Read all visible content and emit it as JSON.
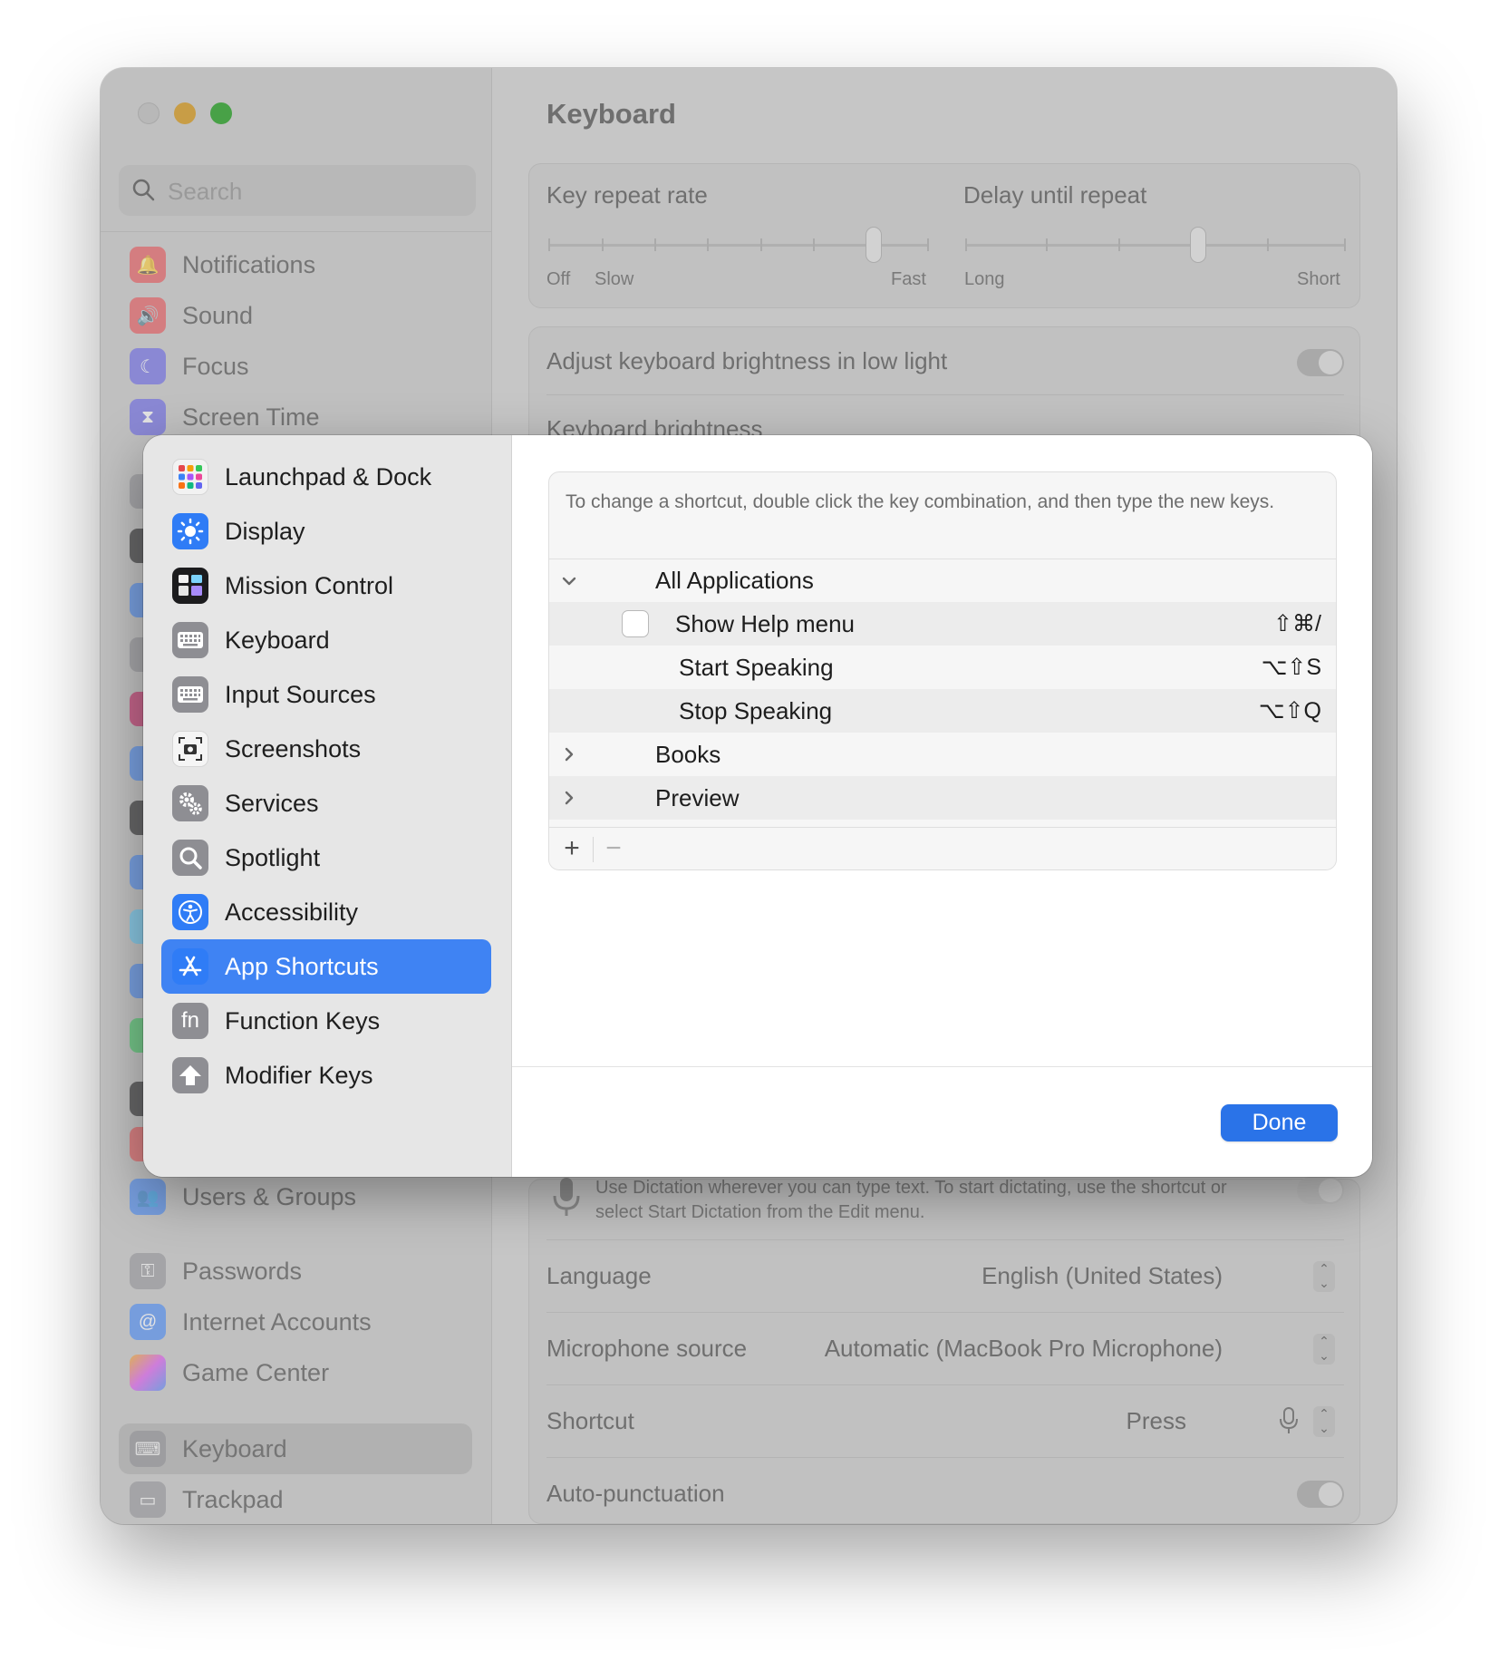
{
  "window": {
    "search_placeholder": "Search",
    "sidebar_items": [
      {
        "label": "Notifications",
        "icon": "bell-icon",
        "color": "#e5484d"
      },
      {
        "label": "Sound",
        "icon": "speaker-icon",
        "color": "#e5484d"
      },
      {
        "label": "Focus",
        "icon": "moon-icon",
        "color": "#5e5ce6"
      },
      {
        "label": "Screen Time",
        "icon": "hourglass-icon",
        "color": "#5e5ce6"
      },
      {
        "label": "Users & Groups",
        "icon": "users-icon",
        "color": "#3b82f6"
      },
      {
        "label": "Passwords",
        "icon": "key-icon",
        "color": "#8e8e93"
      },
      {
        "label": "Internet Accounts",
        "icon": "at-icon",
        "color": "#3b82f6"
      },
      {
        "label": "Game Center",
        "icon": "game-center-icon",
        "color": "#d946ef"
      },
      {
        "label": "Keyboard",
        "icon": "keyboard-icon",
        "color": "#8e8e93"
      },
      {
        "label": "Trackpad",
        "icon": "trackpad-icon",
        "color": "#8e8e93"
      }
    ],
    "main": {
      "title": "Keyboard",
      "key_repeat_label": "Key repeat rate",
      "key_repeat_ticks": [
        "Off",
        "Slow",
        "Fast"
      ],
      "delay_label": "Delay until repeat",
      "delay_ticks": [
        "Long",
        "Short"
      ],
      "brightness_toggle_label": "Adjust keyboard brightness in low light",
      "keyboard_brightness_label": "Keyboard brightness",
      "dictation_desc": "Use Dictation wherever you can type text. To start dictating, use the shortcut or select Start Dictation from the Edit menu.",
      "language_label": "Language",
      "language_value": "English (United States)",
      "mic_label": "Microphone source",
      "mic_value": "Automatic (MacBook Pro Microphone)",
      "shortcut_label": "Shortcut",
      "shortcut_value": "Press",
      "autopunct_label": "Auto-punctuation"
    }
  },
  "sheet": {
    "sidebar": [
      {
        "label": "Launchpad & Dock",
        "icon": "launchpad-icon"
      },
      {
        "label": "Display",
        "icon": "sun-icon"
      },
      {
        "label": "Mission Control",
        "icon": "mission-control-icon"
      },
      {
        "label": "Keyboard",
        "icon": "keyboard-icon"
      },
      {
        "label": "Input Sources",
        "icon": "keyboard-icon"
      },
      {
        "label": "Screenshots",
        "icon": "screenshot-icon"
      },
      {
        "label": "Services",
        "icon": "gears-icon"
      },
      {
        "label": "Spotlight",
        "icon": "magnifier-icon"
      },
      {
        "label": "Accessibility",
        "icon": "accessibility-icon"
      },
      {
        "label": "App Shortcuts",
        "icon": "app-store-icon",
        "selected": true
      },
      {
        "label": "Function Keys",
        "icon": "fn-icon"
      },
      {
        "label": "Modifier Keys",
        "icon": "up-arrow-icon"
      }
    ],
    "hint": "To change a shortcut, double click the key combination, and then type the new keys.",
    "groups": [
      {
        "name": "All Applications",
        "expanded": true
      },
      {
        "name": "Books",
        "expanded": false
      },
      {
        "name": "Preview",
        "expanded": false
      }
    ],
    "shortcuts": [
      {
        "name": "Show Help menu",
        "keys": "⇧⌘/"
      },
      {
        "name": "Start Speaking",
        "keys": "⌥⇧S"
      },
      {
        "name": "Stop Speaking",
        "keys": "⌥⇧Q"
      }
    ],
    "add_label": "+",
    "remove_label": "−",
    "done_label": "Done",
    "accent_color": "#3f83f3"
  }
}
